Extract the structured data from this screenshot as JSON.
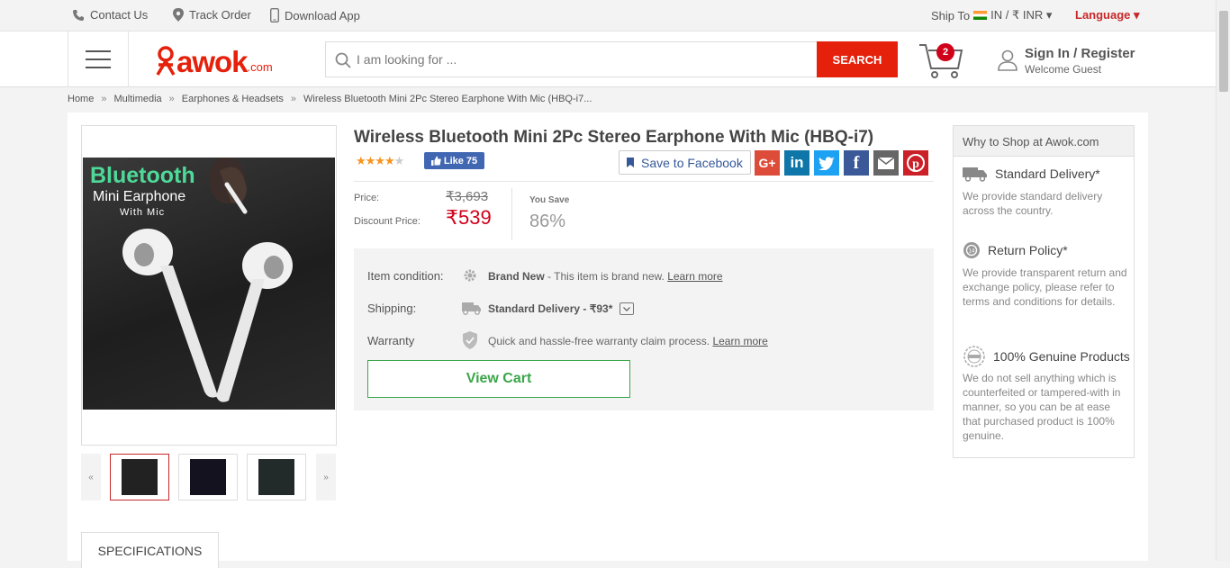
{
  "topbar": {
    "contact": "Contact Us",
    "track": "Track Order",
    "download": "Download App",
    "ship_label": "Ship To",
    "ship_value": "IN / ₹ INR ▾",
    "language": "Language ▾"
  },
  "header": {
    "logo_text": "awok",
    "logo_suffix": ".com",
    "search_placeholder": "I am looking for ...",
    "search_button": "SEARCH",
    "cart_count": "2",
    "signin": "Sign In / Register",
    "welcome": "Welcome Guest"
  },
  "breadcrumb": [
    "Home",
    "Multimedia",
    "Earphones & Headsets",
    "Wireless Bluetooth Mini 2Pc Stereo Earphone With Mic (HBQ-i7..."
  ],
  "product": {
    "image_text1": "Bluetooth",
    "image_text2": "Mini Earphone",
    "image_text3": "With Mic",
    "thumb_prev": "«",
    "thumb_next": "»",
    "title": "Wireless Bluetooth Mini 2Pc Stereo Earphone With Mic (HBQ-i7)",
    "rating_stars": 4,
    "fb_like": "Like 75",
    "save_facebook": "Save to Facebook",
    "price_label": "Price:",
    "old_price": "₹3,693",
    "discount_label": "Discount Price:",
    "new_price": "₹539",
    "you_save_label": "You Save",
    "you_save_value": "86%",
    "condition_label": "Item condition:",
    "condition_bold": "Brand New",
    "condition_text": " - This item is brand new. ",
    "learn_more": "Learn more",
    "shipping_label": "Shipping:",
    "shipping_value": "Standard Delivery - ₹93*",
    "warranty_label": "Warranty",
    "warranty_text": "Quick and hassle-free warranty claim process. ",
    "view_cart": "View Cart",
    "specs_tab": "SPECIFICATIONS"
  },
  "why": {
    "heading": "Why to Shop at Awok.com",
    "items": [
      {
        "title": "Standard Delivery*",
        "desc": "We provide standard delivery across the country."
      },
      {
        "title": "Return Policy*",
        "desc": "We provide transparent return and exchange policy, please refer to terms and conditions for details."
      },
      {
        "title": "100% Genuine Products",
        "desc": "We do not sell anything which is counterfeited or tampered-with in manner, so you can be at ease that purchased product is 100% genuine."
      }
    ]
  },
  "colors": {
    "brand_red": "#e5210c",
    "green": "#3aa64a",
    "price_red": "#d0021b"
  }
}
